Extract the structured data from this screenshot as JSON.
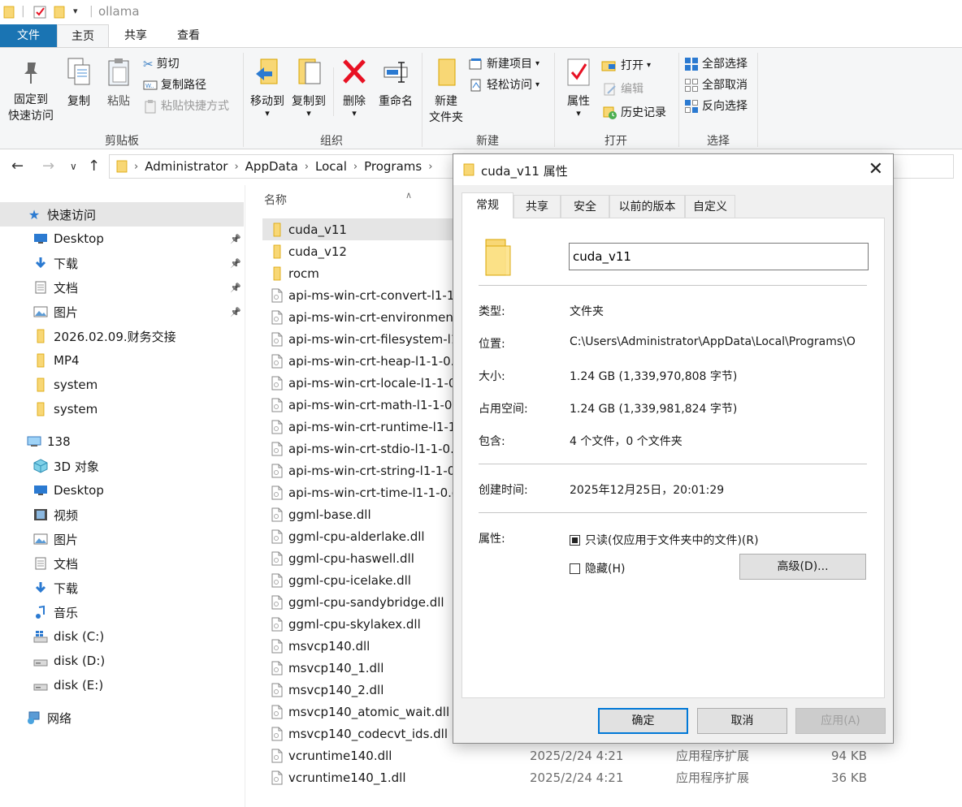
{
  "window": {
    "title": "ollama"
  },
  "ribbon_tabs": [
    "文件",
    "主页",
    "共享",
    "查看"
  ],
  "ribbon": {
    "clipboard": {
      "pin_label_1": "固定到",
      "pin_label_2": "快速访问",
      "copy": "复制",
      "paste": "粘贴",
      "cut": "剪切",
      "copy_path": "复制路径",
      "paste_shortcut": "粘贴快捷方式",
      "group": "剪贴板"
    },
    "organize": {
      "move_to": "移动到",
      "copy_to": "复制到",
      "delete": "删除",
      "rename": "重命名",
      "group": "组织"
    },
    "new": {
      "new_folder_1": "新建",
      "new_folder_2": "文件夹",
      "new_item": "新建项目",
      "easy_access": "轻松访问",
      "group": "新建"
    },
    "open": {
      "properties": "属性",
      "open": "打开",
      "edit": "编辑",
      "history": "历史记录",
      "group": "打开"
    },
    "select": {
      "select_all": "全部选择",
      "select_none": "全部取消",
      "invert": "反向选择",
      "group": "选择"
    }
  },
  "breadcrumb": [
    "Administrator",
    "AppData",
    "Local",
    "Programs"
  ],
  "nav": {
    "quick_access": "快速访问",
    "items": [
      {
        "label": "Desktop",
        "icon": "desktop-icon",
        "pinned": true
      },
      {
        "label": "下载",
        "icon": "download-icon",
        "pinned": true
      },
      {
        "label": "文档",
        "icon": "document-icon",
        "pinned": true
      },
      {
        "label": "图片",
        "icon": "picture-icon",
        "pinned": true
      },
      {
        "label": "2026.02.09.财务交接",
        "icon": "folder-icon",
        "pinned": false
      },
      {
        "label": "MP4",
        "icon": "folder-icon",
        "pinned": false
      },
      {
        "label": "system",
        "icon": "folder-icon",
        "pinned": false
      },
      {
        "label": "system",
        "icon": "folder-icon",
        "pinned": false
      }
    ],
    "pc": "138",
    "pc_items": [
      {
        "label": "3D 对象",
        "icon": "3d-objects-icon"
      },
      {
        "label": "Desktop",
        "icon": "desktop-icon"
      },
      {
        "label": "视频",
        "icon": "video-icon"
      },
      {
        "label": "图片",
        "icon": "picture-icon"
      },
      {
        "label": "文档",
        "icon": "document-icon"
      },
      {
        "label": "下载",
        "icon": "download-icon"
      },
      {
        "label": "音乐",
        "icon": "music-icon"
      },
      {
        "label": "disk (C:)",
        "icon": "windows-drive-icon"
      },
      {
        "label": "disk (D:)",
        "icon": "drive-icon"
      },
      {
        "label": "disk (E:)",
        "icon": "drive-icon"
      }
    ],
    "network": "网络"
  },
  "filelist": {
    "col_name": "名称",
    "rows": [
      {
        "name": "cuda_v11",
        "type": "folder",
        "date": "",
        "kind": "",
        "size": ""
      },
      {
        "name": "cuda_v12",
        "type": "folder",
        "date": "",
        "kind": "",
        "size": ""
      },
      {
        "name": "rocm",
        "type": "folder",
        "date": "",
        "kind": "",
        "size": ""
      },
      {
        "name": "api-ms-win-crt-convert-l1-1-",
        "type": "file",
        "date": "",
        "kind": "",
        "size": ""
      },
      {
        "name": "api-ms-win-crt-environment",
        "type": "file",
        "date": "",
        "kind": "",
        "size": ""
      },
      {
        "name": "api-ms-win-crt-filesystem-l1",
        "type": "file",
        "date": "",
        "kind": "",
        "size": ""
      },
      {
        "name": "api-ms-win-crt-heap-l1-1-0.d",
        "type": "file",
        "date": "",
        "kind": "",
        "size": ""
      },
      {
        "name": "api-ms-win-crt-locale-l1-1-0",
        "type": "file",
        "date": "",
        "kind": "",
        "size": ""
      },
      {
        "name": "api-ms-win-crt-math-l1-1-0.d",
        "type": "file",
        "date": "",
        "kind": "",
        "size": ""
      },
      {
        "name": "api-ms-win-crt-runtime-l1-1",
        "type": "file",
        "date": "",
        "kind": "",
        "size": ""
      },
      {
        "name": "api-ms-win-crt-stdio-l1-1-0.",
        "type": "file",
        "date": "",
        "kind": "",
        "size": ""
      },
      {
        "name": "api-ms-win-crt-string-l1-1-0.",
        "type": "file",
        "date": "",
        "kind": "",
        "size": ""
      },
      {
        "name": "api-ms-win-crt-time-l1-1-0.d",
        "type": "file",
        "date": "",
        "kind": "",
        "size": ""
      },
      {
        "name": "ggml-base.dll",
        "type": "file",
        "date": "",
        "kind": "",
        "size": ""
      },
      {
        "name": "ggml-cpu-alderlake.dll",
        "type": "file",
        "date": "",
        "kind": "",
        "size": ""
      },
      {
        "name": "ggml-cpu-haswell.dll",
        "type": "file",
        "date": "",
        "kind": "",
        "size": ""
      },
      {
        "name": "ggml-cpu-icelake.dll",
        "type": "file",
        "date": "",
        "kind": "",
        "size": ""
      },
      {
        "name": "ggml-cpu-sandybridge.dll",
        "type": "file",
        "date": "",
        "kind": "",
        "size": ""
      },
      {
        "name": "ggml-cpu-skylakex.dll",
        "type": "file",
        "date": "",
        "kind": "",
        "size": ""
      },
      {
        "name": "msvcp140.dll",
        "type": "file",
        "date": "",
        "kind": "",
        "size": ""
      },
      {
        "name": "msvcp140_1.dll",
        "type": "file",
        "date": "",
        "kind": "",
        "size": ""
      },
      {
        "name": "msvcp140_2.dll",
        "type": "file",
        "date": "",
        "kind": "",
        "size": ""
      },
      {
        "name": "msvcp140_atomic_wait.dll",
        "type": "file",
        "date": "",
        "kind": "",
        "size": ""
      },
      {
        "name": "msvcp140_codecvt_ids.dll",
        "type": "file",
        "date": "",
        "kind": "",
        "size": ""
      },
      {
        "name": "vcruntime140.dll",
        "type": "file",
        "date": "2025/2/24 4:21",
        "kind": "应用程序扩展",
        "size": "94 KB"
      },
      {
        "name": "vcruntime140_1.dll",
        "type": "file",
        "date": "2025/2/24 4:21",
        "kind": "应用程序扩展",
        "size": "36 KB"
      }
    ]
  },
  "dialog": {
    "title": "cuda_v11 属性",
    "tabs": [
      "常规",
      "共享",
      "安全",
      "以前的版本",
      "自定义"
    ],
    "name_value": "cuda_v11",
    "type_label": "类型:",
    "type_value": "文件夹",
    "location_label": "位置:",
    "location_value": "C:\\Users\\Administrator\\AppData\\Local\\Programs\\O",
    "size_label": "大小:",
    "size_value": "1.24 GB (1,339,970,808 字节)",
    "disk_size_label": "占用空间:",
    "disk_size_value": "1.24 GB (1,339,981,824 字节)",
    "contains_label": "包含:",
    "contains_value": "4 个文件，0 个文件夹",
    "created_label": "创建时间:",
    "created_value": "2025年12月25日，20:01:29",
    "attributes_label": "属性:",
    "readonly_label": "只读(仅应用于文件夹中的文件)(R)",
    "readonly_state": "indeterminate",
    "hidden_label": "隐藏(H)",
    "hidden_checked": false,
    "advanced_button": "高级(D)...",
    "ok_button": "确定",
    "cancel_button": "取消",
    "apply_button": "应用(A)"
  },
  "colors": {
    "file_tab": "#1a74b3",
    "delete_red": "#e81123",
    "folder_yellow": "#f8d775",
    "primary_border": "#0078d7"
  }
}
